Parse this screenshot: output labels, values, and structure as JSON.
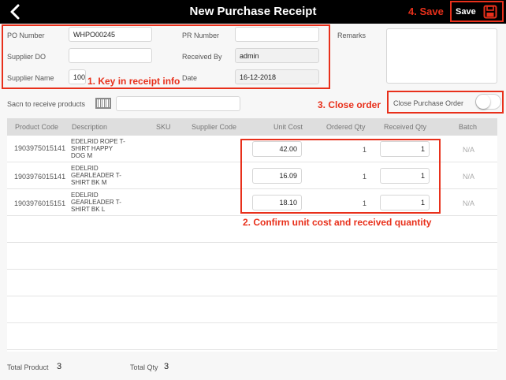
{
  "header": {
    "title": "New Purchase Receipt",
    "save_annotation": "4. Save",
    "save_label": "Save"
  },
  "form": {
    "po_number": {
      "label": "PO Number",
      "value": "WHPO00245"
    },
    "pr_number": {
      "label": "PR Number",
      "value": ""
    },
    "remarks": {
      "label": "Remarks",
      "value": ""
    },
    "supplier_do": {
      "label": "Supplier DO",
      "value": ""
    },
    "received_by": {
      "label": "Received By",
      "value": "admin"
    },
    "supplier_name": {
      "label": "Supplier Name",
      "value": "100"
    },
    "date": {
      "label": "Date",
      "value": "16-12-2018"
    },
    "scan_label": "Sacn to receive products",
    "scan_value": "",
    "close_order_label": "Close Purchase Order",
    "close_order_on": false
  },
  "annotations": {
    "step1": "1. Key in receipt info",
    "step2": "2. Confirm unit cost and received quantity",
    "step3": "3. Close order"
  },
  "table": {
    "columns": [
      "Product Code",
      "Description",
      "SKU",
      "Supplier Code",
      "Unit Cost",
      "Ordered Qty",
      "Received Qty",
      "Batch"
    ],
    "rows": [
      {
        "code": "1903975015141",
        "desc1": "EDELRID ROPE T-",
        "desc2": "SHIRT HAPPY",
        "desc3": "DOG M",
        "sku": "",
        "supplier_code": "",
        "unit_cost": "42.00",
        "ordered_qty": "1",
        "received_qty": "1",
        "batch": "N/A"
      },
      {
        "code": "1903976015141",
        "desc1": "EDELRID",
        "desc2": "GEARLEADER T-",
        "desc3": "SHIRT BK M",
        "sku": "",
        "supplier_code": "",
        "unit_cost": "16.09",
        "ordered_qty": "1",
        "received_qty": "1",
        "batch": "N/A"
      },
      {
        "code": "1903976015151",
        "desc1": "EDELRID",
        "desc2": "GEARLEADER T-",
        "desc3": "SHIRT BK L",
        "sku": "",
        "supplier_code": "",
        "unit_cost": "18.10",
        "ordered_qty": "1",
        "received_qty": "1",
        "batch": "N/A"
      }
    ]
  },
  "footer": {
    "total_product_label": "Total Product",
    "total_product_value": "3",
    "total_qty_label": "Total Qty",
    "total_qty_value": "3"
  },
  "colors": {
    "accent_red": "#e8301b",
    "header_bg": "#000000"
  },
  "icons": {
    "back": "chevron-left-icon",
    "save": "floppy-disk-icon",
    "barcode": "barcode-icon"
  }
}
